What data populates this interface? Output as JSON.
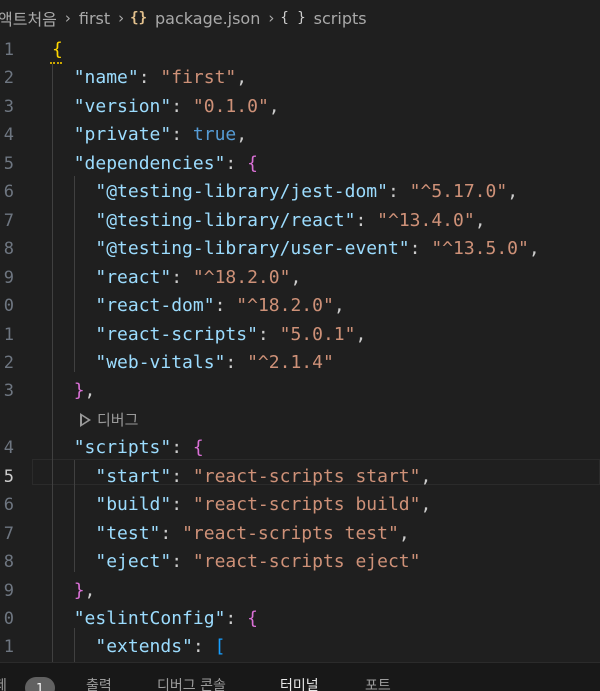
{
  "breadcrumb": {
    "items": [
      "액트처음",
      "first",
      "package.json",
      "scripts"
    ],
    "json_icon": "{}",
    "object_icon": "{ }",
    "separator": "›"
  },
  "editor": {
    "active_line": "5",
    "codelens_label": "디버그",
    "lines": [
      {
        "no": "1",
        "tokens": [
          {
            "t": "{",
            "c": "b1"
          }
        ]
      },
      {
        "no": "2",
        "tokens": [
          {
            "t": "  "
          },
          {
            "t": "\"name\"",
            "c": "key"
          },
          {
            "t": ": "
          },
          {
            "t": "\"first\"",
            "c": "str"
          },
          {
            "t": ","
          }
        ]
      },
      {
        "no": "3",
        "tokens": [
          {
            "t": "  "
          },
          {
            "t": "\"version\"",
            "c": "key"
          },
          {
            "t": ": "
          },
          {
            "t": "\"0.1.0\"",
            "c": "str"
          },
          {
            "t": ","
          }
        ]
      },
      {
        "no": "4",
        "tokens": [
          {
            "t": "  "
          },
          {
            "t": "\"private\"",
            "c": "key"
          },
          {
            "t": ": "
          },
          {
            "t": "true",
            "c": "kw"
          },
          {
            "t": ","
          }
        ]
      },
      {
        "no": "5",
        "tokens": [
          {
            "t": "  "
          },
          {
            "t": "\"dependencies\"",
            "c": "key"
          },
          {
            "t": ": "
          },
          {
            "t": "{",
            "c": "b2"
          }
        ]
      },
      {
        "no": "6",
        "tokens": [
          {
            "t": "    "
          },
          {
            "t": "\"@testing-library/jest-dom\"",
            "c": "key"
          },
          {
            "t": ": "
          },
          {
            "t": "\"^5.17.0\"",
            "c": "str"
          },
          {
            "t": ","
          }
        ]
      },
      {
        "no": "7",
        "tokens": [
          {
            "t": "    "
          },
          {
            "t": "\"@testing-library/react\"",
            "c": "key"
          },
          {
            "t": ": "
          },
          {
            "t": "\"^13.4.0\"",
            "c": "str"
          },
          {
            "t": ","
          }
        ]
      },
      {
        "no": "8",
        "tokens": [
          {
            "t": "    "
          },
          {
            "t": "\"@testing-library/user-event\"",
            "c": "key"
          },
          {
            "t": ": "
          },
          {
            "t": "\"^13.5.0\"",
            "c": "str"
          },
          {
            "t": ","
          }
        ]
      },
      {
        "no": "9",
        "tokens": [
          {
            "t": "    "
          },
          {
            "t": "\"react\"",
            "c": "key"
          },
          {
            "t": ": "
          },
          {
            "t": "\"^18.2.0\"",
            "c": "str"
          },
          {
            "t": ","
          }
        ]
      },
      {
        "no": "0",
        "tokens": [
          {
            "t": "    "
          },
          {
            "t": "\"react-dom\"",
            "c": "key"
          },
          {
            "t": ": "
          },
          {
            "t": "\"^18.2.0\"",
            "c": "str"
          },
          {
            "t": ","
          }
        ]
      },
      {
        "no": "1",
        "tokens": [
          {
            "t": "    "
          },
          {
            "t": "\"react-scripts\"",
            "c": "key"
          },
          {
            "t": ": "
          },
          {
            "t": "\"5.0.1\"",
            "c": "str"
          },
          {
            "t": ","
          }
        ]
      },
      {
        "no": "2",
        "tokens": [
          {
            "t": "    "
          },
          {
            "t": "\"web-vitals\"",
            "c": "key"
          },
          {
            "t": ": "
          },
          {
            "t": "\"^2.1.4\"",
            "c": "str"
          }
        ]
      },
      {
        "no": "3",
        "tokens": [
          {
            "t": "  "
          },
          {
            "t": "}",
            "c": "b2"
          },
          {
            "t": ","
          }
        ]
      },
      {
        "no": "",
        "codelens": true
      },
      {
        "no": "4",
        "tokens": [
          {
            "t": "  "
          },
          {
            "t": "\"scripts\"",
            "c": "key"
          },
          {
            "t": ": "
          },
          {
            "t": "{",
            "c": "b2"
          }
        ]
      },
      {
        "no": "5",
        "active": true,
        "tokens": [
          {
            "t": "    "
          },
          {
            "t": "\"start\"",
            "c": "key"
          },
          {
            "t": ": "
          },
          {
            "t": "\"react-scripts start\"",
            "c": "str"
          },
          {
            "t": ","
          }
        ]
      },
      {
        "no": "6",
        "tokens": [
          {
            "t": "    "
          },
          {
            "t": "\"build\"",
            "c": "key"
          },
          {
            "t": ": "
          },
          {
            "t": "\"react-scripts build\"",
            "c": "str"
          },
          {
            "t": ","
          }
        ]
      },
      {
        "no": "7",
        "tokens": [
          {
            "t": "    "
          },
          {
            "t": "\"test\"",
            "c": "key"
          },
          {
            "t": ": "
          },
          {
            "t": "\"react-scripts test\"",
            "c": "str"
          },
          {
            "t": ","
          }
        ]
      },
      {
        "no": "8",
        "tokens": [
          {
            "t": "    "
          },
          {
            "t": "\"eject\"",
            "c": "key"
          },
          {
            "t": ": "
          },
          {
            "t": "\"react-scripts eject\"",
            "c": "str"
          }
        ]
      },
      {
        "no": "9",
        "tokens": [
          {
            "t": "  "
          },
          {
            "t": "}",
            "c": "b2"
          },
          {
            "t": ","
          }
        ]
      },
      {
        "no": "0",
        "tokens": [
          {
            "t": "  "
          },
          {
            "t": "\"eslintConfig\"",
            "c": "key"
          },
          {
            "t": ": "
          },
          {
            "t": "{",
            "c": "b2"
          }
        ]
      },
      {
        "no": "1",
        "tokens": [
          {
            "t": "    "
          },
          {
            "t": "\"extends\"",
            "c": "key"
          },
          {
            "t": ": "
          },
          {
            "t": "[",
            "c": "b3"
          }
        ]
      }
    ]
  },
  "panel": {
    "left_partial": "제",
    "badge": "1",
    "tabs": [
      {
        "label": "출력",
        "active": false
      },
      {
        "label": "디버그 콘솔",
        "active": false
      },
      {
        "label": "터미널",
        "active": true
      },
      {
        "label": "포트",
        "active": false
      }
    ]
  },
  "colors": {
    "background": "#1f1f1f",
    "key": "#9cdcfe",
    "string": "#ce9178",
    "keyword": "#569cd6",
    "bracket_level1": "#ffd700",
    "bracket_level2": "#da70d6",
    "bracket_level3": "#179fff"
  }
}
